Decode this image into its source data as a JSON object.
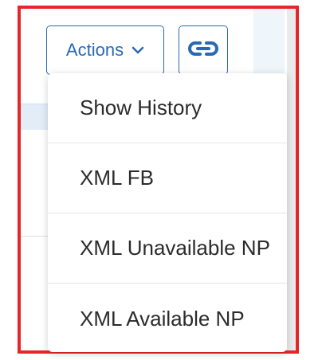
{
  "toolbar": {
    "actions_label": "Actions",
    "chevron_icon": "chevron-down-icon",
    "link_icon": "link-icon",
    "accent_color": "#2a6ab1"
  },
  "actions_menu": {
    "items": [
      {
        "label": "Show History"
      },
      {
        "label": "XML FB"
      },
      {
        "label": "XML Unavailable NP"
      },
      {
        "label": "XML Available NP"
      }
    ]
  },
  "highlight": {
    "color": "#e8262a"
  }
}
